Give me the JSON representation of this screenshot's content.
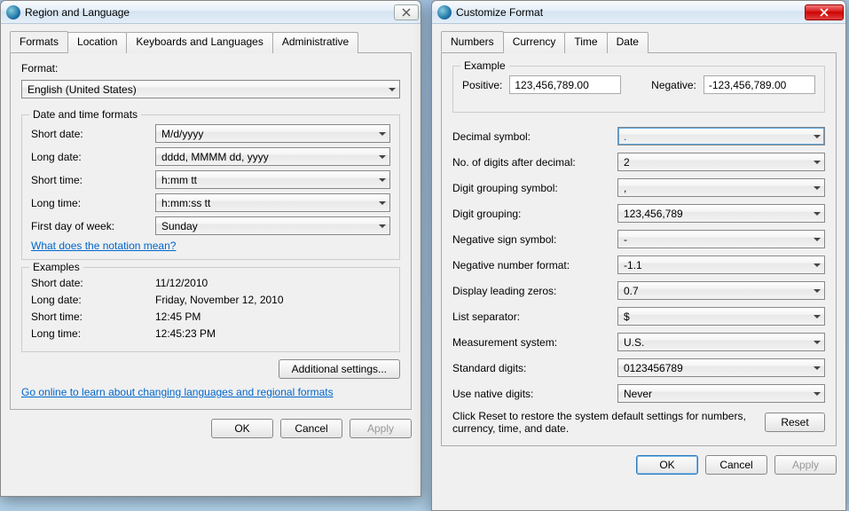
{
  "region": {
    "title": "Region and Language",
    "tabs": [
      "Formats",
      "Location",
      "Keyboards and Languages",
      "Administrative"
    ],
    "format_label": "Format:",
    "format_value": "English (United States)",
    "group_datetime": "Date and time formats",
    "rows": {
      "short_date_lbl": "Short date:",
      "short_date_val": "M/d/yyyy",
      "long_date_lbl": "Long date:",
      "long_date_val": "dddd, MMMM dd, yyyy",
      "short_time_lbl": "Short time:",
      "short_time_val": "h:mm tt",
      "long_time_lbl": "Long time:",
      "long_time_val": "h:mm:ss tt",
      "first_day_lbl": "First day of week:",
      "first_day_val": "Sunday"
    },
    "notation_link": "What does the notation mean?",
    "group_examples": "Examples",
    "examples": {
      "short_date_lbl": "Short date:",
      "short_date_val": "11/12/2010",
      "long_date_lbl": "Long date:",
      "long_date_val": "Friday, November 12, 2010",
      "short_time_lbl": "Short time:",
      "short_time_val": "12:45 PM",
      "long_time_lbl": "Long time:",
      "long_time_val": "12:45:23 PM"
    },
    "additional_btn": "Additional settings...",
    "online_link": "Go online to learn about changing languages and regional formats",
    "ok": "OK",
    "cancel": "Cancel",
    "apply": "Apply"
  },
  "customize": {
    "title": "Customize Format",
    "tabs": [
      "Numbers",
      "Currency",
      "Time",
      "Date"
    ],
    "example_legend": "Example",
    "positive_lbl": "Positive:",
    "positive_val": "123,456,789.00",
    "negative_lbl": "Negative:",
    "negative_val": "-123,456,789.00",
    "rows": {
      "decimal_symbol_lbl": "Decimal symbol:",
      "decimal_symbol_val": ".",
      "digits_after_lbl": "No. of digits after decimal:",
      "digits_after_val": "2",
      "grouping_symbol_lbl": "Digit grouping symbol:",
      "grouping_symbol_val": ",",
      "grouping_lbl": "Digit grouping:",
      "grouping_val": "123,456,789",
      "neg_sign_lbl": "Negative sign symbol:",
      "neg_sign_val": "-",
      "neg_fmt_lbl": "Negative number format:",
      "neg_fmt_val": "-1.1",
      "leading_zeros_lbl": "Display leading zeros:",
      "leading_zeros_val": "0.7",
      "list_sep_lbl": "List separator:",
      "list_sep_val": "$",
      "measurement_lbl": "Measurement system:",
      "measurement_val": "U.S.",
      "std_digits_lbl": "Standard digits:",
      "std_digits_val": "0123456789",
      "native_digits_lbl": "Use native digits:",
      "native_digits_val": "Never"
    },
    "reset_hint": "Click Reset to restore the system default settings for numbers, currency, time, and date.",
    "reset_btn": "Reset",
    "ok": "OK",
    "cancel": "Cancel",
    "apply": "Apply"
  }
}
